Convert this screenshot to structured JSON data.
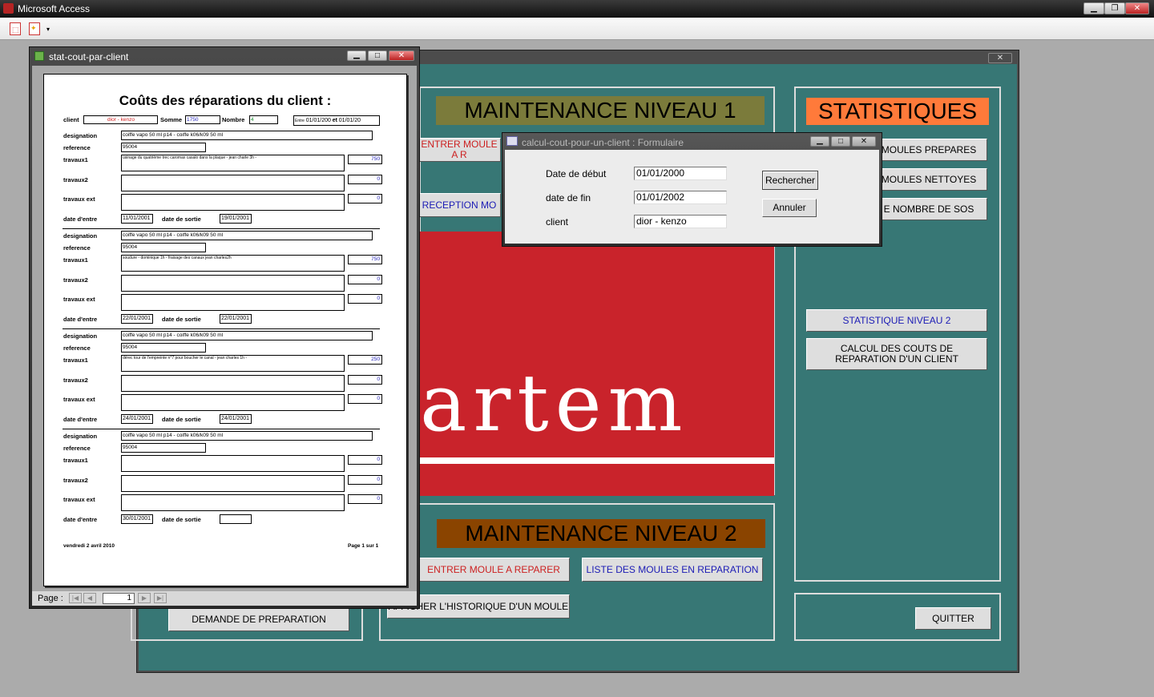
{
  "app": {
    "title": "Microsoft Access"
  },
  "report_window": {
    "title": "stat-cout-par-client",
    "heading": "Coûts des réparations du client :",
    "client_label": "client",
    "client_value": "dior - kenzo",
    "somme_label": "Somme",
    "somme_value": "1750",
    "nombre_label": "Nombre",
    "nombre_value": "4",
    "entre_label": "Entre",
    "entre_value": "01/01/200",
    "et_label": "et",
    "et_value": "01/01/20",
    "labels": {
      "designation": "designation",
      "reference": "reference",
      "travaux1": "travaux1",
      "travaux2": "travaux2",
      "travaux_ext": "travaux ext",
      "date_entree": "date d'entre",
      "date_sortie": "date de sortie"
    },
    "records": [
      {
        "designation": "coiffe vapo 50 ml p14 - coiffe k06/k09 50 ml",
        "reference": "95004",
        "travaux1_text": "usinage du quatrième trec caromax casalo dans la plaque - jean charle 3h -",
        "travaux1_cost": "750",
        "travaux2_cost": "0",
        "travaux_ext_cost": "0",
        "date_entree": "11/01/2001",
        "date_sortie": "19/01/2001"
      },
      {
        "designation": "coiffe vapo 50 ml p14 - coiffe k06/k09 50 ml",
        "reference": "95004",
        "travaux1_text": "soudure - dominique 1h - fraisage des canaux jean charles2h",
        "travaux1_cost": "750",
        "travaux2_cost": "0",
        "travaux_ext_cost": "0",
        "date_entree": "22/01/2001",
        "date_sortie": "22/01/2001"
      },
      {
        "designation": "coiffe vapo 50 ml p14 - coiffe k06/k09 50 ml",
        "reference": "95004",
        "travaux1_text": "dérec tour de l'empreinte n°7 pour boucher le canal - jean charles 1h -",
        "travaux1_cost": "250",
        "travaux2_cost": "0",
        "travaux_ext_cost": "0",
        "date_entree": "24/01/2001",
        "date_sortie": "24/01/2001"
      },
      {
        "designation": "coiffe vapo 50 ml p14 - coiffe k06/k09 50 ml",
        "reference": "95004",
        "travaux1_text": "",
        "travaux1_cost": "0",
        "travaux2_cost": "0",
        "travaux_ext_cost": "0",
        "date_entree": "30/01/2001",
        "date_sortie": ""
      }
    ],
    "footer_date": "vendredi 2 avril 2010",
    "footer_page": "Page 1 sur 1",
    "nav_label": "Page :",
    "nav_page": "1"
  },
  "main_form": {
    "niveau1_title": "MAINTENANCE NIVEAU 1",
    "niveau2_title": "MAINTENANCE NIVEAU 2",
    "stats_title": "STATISTIQUES",
    "btn_entrer1": "ENTRER MOULE A R",
    "btn_reception": "RECEPTION MO",
    "btn_entrer2": "ENTRER MOULE A REPARER",
    "btn_liste": "LISTE DES MOULES EN REPARATION",
    "btn_historique": "AFFICHER L'HISTORIQUE D'UN MOULE",
    "btn_demande": "DEMANDE DE PREPARATION",
    "btn_moules_prepares": "MOULES PREPARES",
    "btn_moules_nettoyes": "MOULES NETTOYES",
    "btn_nombre_sos": "E NOMBRE DE SOS",
    "btn_stat2": "STATISTIQUE NIVEAU 2",
    "btn_calcul": "CALCUL DES COUTS DE REPARATION D'UN CLIENT",
    "btn_quitter": "QUITTER",
    "logo_text": "artem"
  },
  "dialog": {
    "title": "calcul-cout-pour-un-client : Formulaire",
    "start_label": "Date de début",
    "start_value": "01/01/2000",
    "end_label": "date de fin",
    "end_value": "01/01/2002",
    "client_label": "client",
    "client_value": "dior - kenzo",
    "search_button": "Rechercher",
    "cancel_button": "Annuler"
  },
  "colors": {
    "teal": "#377775",
    "olive": "#7b7b3b",
    "orange": "#ff7a3a",
    "brown": "#8a4400",
    "red": "#c9232b"
  }
}
